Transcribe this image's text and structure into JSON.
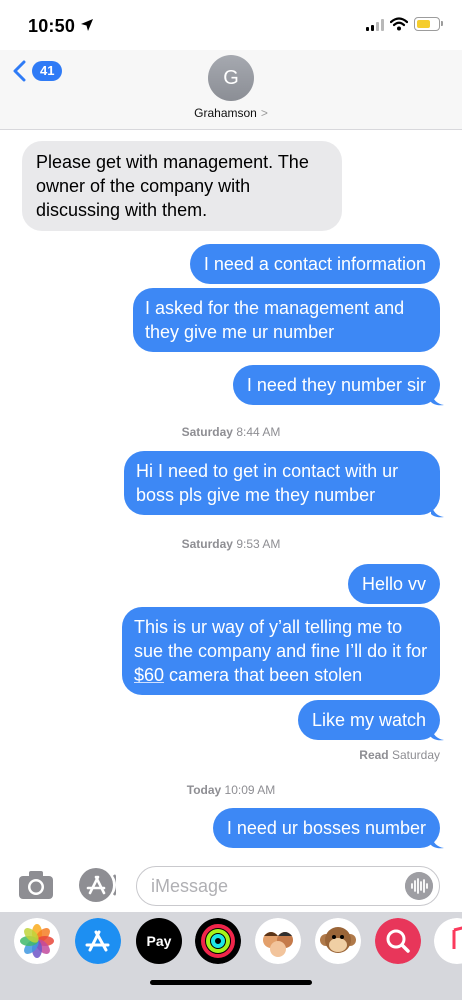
{
  "status_bar": {
    "time": "10:50",
    "signal_bars": 2,
    "battery_color": "#f5cd2c"
  },
  "header": {
    "back_count": "41",
    "avatar_initial": "G",
    "contact_name": "Grahamson",
    "contact_chevron": ">"
  },
  "messages": [
    {
      "from": "them",
      "text": "Please get with management. The owner of the company with discussing with them."
    },
    {
      "from": "me",
      "text": "I need a contact information"
    },
    {
      "from": "me",
      "text": "I asked for the management and they give me ur number"
    },
    {
      "from": "me",
      "text": "I need they number sir"
    },
    {
      "timestamp_day": "Saturday",
      "timestamp_time": "8:44 AM"
    },
    {
      "from": "me",
      "text": "Hi I need to get in contact with ur boss pls give me they number"
    },
    {
      "timestamp_day": "Saturday",
      "timestamp_time": "9:53 AM"
    },
    {
      "from": "me",
      "text": "Hello vv"
    },
    {
      "from": "me",
      "text_before": "This is ur way of y’all telling me to sue the company and fine I’ll do it for ",
      "link": "$60",
      "text_after": " camera that been stolen"
    },
    {
      "from": "me",
      "text": "Like my watch"
    },
    {
      "read_label": "Read",
      "read_when": "Saturday"
    },
    {
      "timestamp_day": "Today",
      "timestamp_time": "10:09 AM"
    },
    {
      "from": "me",
      "text": "I need ur bosses number"
    }
  ],
  "composer": {
    "placeholder": "iMessage"
  },
  "app_drawer": [
    {
      "icon": "photos-icon"
    },
    {
      "icon": "app-store-icon"
    },
    {
      "icon": "apple-pay-icon",
      "label": "Pay"
    },
    {
      "icon": "activity-rings-icon"
    },
    {
      "icon": "memoji-icon"
    },
    {
      "icon": "monkey-animoji-icon"
    },
    {
      "icon": "image-search-icon"
    },
    {
      "icon": "music-icon"
    }
  ],
  "colors": {
    "sent_bubble": "#3d88f5",
    "received_bubble": "#e9e9eb",
    "accent": "#2f7bf6"
  }
}
